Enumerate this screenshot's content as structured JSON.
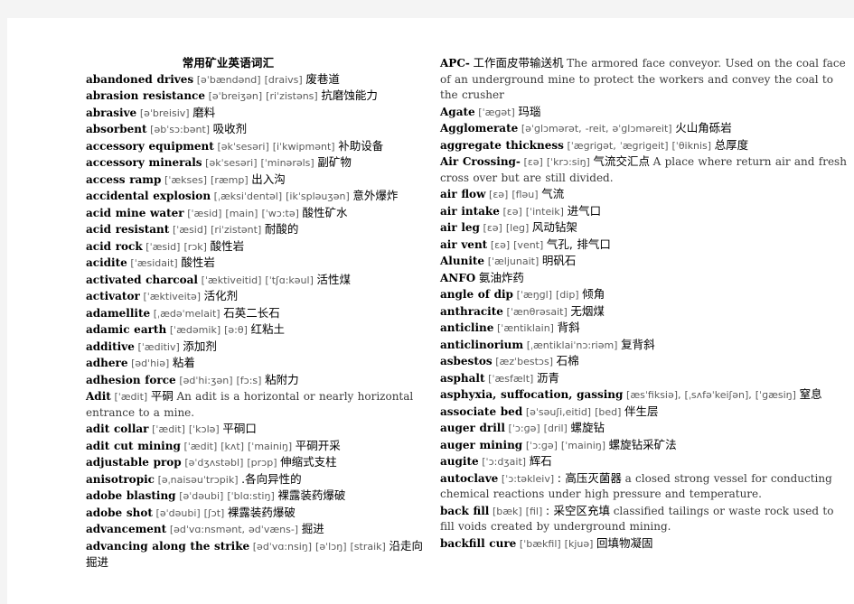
{
  "document": {
    "title": "常用矿业英语词汇",
    "background_color": "#f4f4f4",
    "page_color": "#ffffff",
    "text_color": "#000000",
    "phonetic_color": "#5a5a5a"
  },
  "left_column": {
    "entries": [
      {
        "headword": "abandoned drives",
        "phonetic": "[əˈbændənd]  [draivs]",
        "chinese": "废巷道",
        "english": ""
      },
      {
        "headword": "abrasion resistance",
        "phonetic": "[əˈbreiʒən] [riˈzistəns]",
        "chinese": "抗磨蚀能力",
        "english": ""
      },
      {
        "headword": "abrasive",
        "phonetic": "[əˈbreisiv]",
        "chinese": "磨料",
        "english": ""
      },
      {
        "headword": "absorbent",
        "phonetic": "[əbˈsɔ:bənt]",
        "chinese": "吸收剂",
        "english": ""
      },
      {
        "headword": "accessory equipment",
        "phonetic": "[əkˈsesəri] [iˈkwipmənt]",
        "chinese": "补助设备",
        "english": ""
      },
      {
        "headword": "accessory minerals",
        "phonetic": "[əkˈsesəri] [ˈminərəls]",
        "chinese": "副矿物",
        "english": ""
      },
      {
        "headword": "access ramp",
        "phonetic": "[ˈækses] [ræmp]",
        "chinese": "出入沟",
        "english": ""
      },
      {
        "headword": "accidental explosion",
        "phonetic": "[ˌæksiˈdentəl] [ikˈspləuʒən]",
        "chinese": "意外爆炸",
        "english": ""
      },
      {
        "headword": "acid mine water",
        "phonetic": "[ˈæsid] [main] [ˈwɔ:tə]",
        "chinese": "酸性矿水",
        "english": ""
      },
      {
        "headword": "acid resistant",
        "phonetic": "[ˈæsid] [riˈzistənt]",
        "chinese": "耐酸的",
        "english": ""
      },
      {
        "headword": "acid rock",
        "phonetic": "[ˈæsid] [rɔk]",
        "chinese": "酸性岩",
        "english": ""
      },
      {
        "headword": "acidite",
        "phonetic": "[ˈæsidait]",
        "chinese": "酸性岩",
        "english": ""
      },
      {
        "headword": "activated charcoal",
        "phonetic": "[ˈæktiveitid] [ˈtʃɑ:kəul]",
        "chinese": "活性煤",
        "english": ""
      },
      {
        "headword": "activator",
        "phonetic": "[ˈæktiveitə]",
        "chinese": "活化剂",
        "english": ""
      },
      {
        "headword": "adamellite",
        "phonetic": "[ˌædəˈmelait]",
        "chinese": "石英二长石",
        "english": ""
      },
      {
        "headword": "adamic earth",
        "phonetic": "[ˈædəmik] [ə:θ]",
        "chinese": "红粘土",
        "english": ""
      },
      {
        "headword": "additive",
        "phonetic": "[ˈæditiv]",
        "chinese": "添加剂",
        "english": ""
      },
      {
        "headword": "adhere",
        "phonetic": "[ədˈhiə]",
        "chinese": "粘着",
        "english": ""
      },
      {
        "headword": "adhesion force",
        "phonetic": "[ədˈhi:ʒən] [fɔ:s]",
        "chinese": "粘附力",
        "english": ""
      },
      {
        "headword": "Adit",
        "phonetic": "[ˈædit]",
        "chinese": "平硐",
        "english": "An adit is a horizontal or nearly horizontal entrance to a mine."
      },
      {
        "headword": "adit collar",
        "phonetic": "[ˈædit] [ˈkɔlə]",
        "chinese": "平硐口",
        "english": ""
      },
      {
        "headword": "adit cut mining",
        "phonetic": "[ˈædit] [kʌt] [ˈmainiŋ]",
        "chinese": "平硐开采",
        "english": ""
      },
      {
        "headword": "adjustable prop",
        "phonetic": "[əˈdʒʌstəbl] [prɔp]",
        "chinese": "伸缩式支柱",
        "english": ""
      },
      {
        "headword": "anisotropic",
        "phonetic": "[əˌnaisəuˈtrɔpik]",
        "chinese": ".各向异性的",
        "english": ""
      },
      {
        "headword": "adobe blasting",
        "phonetic": "[əˈdəubi] [ˈblɑ:stiŋ]",
        "chinese": "裸露装药爆破",
        "english": ""
      },
      {
        "headword": "adobe shot",
        "phonetic": "[əˈdəubi] [ʃɔt]",
        "chinese": "裸露装药爆破",
        "english": ""
      },
      {
        "headword": "advancement",
        "phonetic": "[ədˈvɑ:nsmənt, ədˈvæns-]",
        "chinese": "掘进",
        "english": ""
      },
      {
        "headword": "advancing along the strike",
        "phonetic": "[ədˈvɑ:nsiŋ] [əˈlɔŋ]  [straik]",
        "chinese": "沿走向掘进",
        "english": ""
      }
    ]
  },
  "right_column": {
    "entries": [
      {
        "headword": "APC-",
        "phonetic": "",
        "chinese": "工作面皮带输送机",
        "english": "The armored face  conveyor. Used on the coal face of an underground mine to protect the workers and convey the coal to the crusher"
      },
      {
        "headword": "Agate",
        "phonetic": "[ˈæɡət]",
        "chinese": "玛瑙",
        "english": ""
      },
      {
        "headword": "Agglomerate",
        "phonetic": "[əˈɡlɔmərət, -reit, əˈɡlɔməreit]",
        "chinese": "火山角砾岩",
        "english": ""
      },
      {
        "headword": "aggregate thickness",
        "phonetic": "[ˈæɡriɡət, ˈæɡriɡeit] [ˈθiknis]",
        "chinese": "总厚度",
        "english": ""
      },
      {
        "headword": "Air Crossing-",
        "phonetic": "[ɛə] [ˈkrɔ:siŋ]",
        "chinese": "气流交汇点",
        "english": "A place where return air and fresh cross over but are still divided."
      },
      {
        "headword": "air flow",
        "phonetic": "[ɛə] [fləu]",
        "chinese": "气流",
        "english": ""
      },
      {
        "headword": "air intake",
        "phonetic": "[ɛə] [ˈinteik]",
        "chinese": "进气口",
        "english": ""
      },
      {
        "headword": "air leg",
        "phonetic": "[ɛə] [leɡ]",
        "chinese": "风动钻架",
        "english": ""
      },
      {
        "headword": "air vent",
        "phonetic": "[ɛə]  [vent]",
        "chinese": "气孔, 排气口",
        "english": ""
      },
      {
        "headword": "Alunite",
        "phonetic": "[ˈæljunait]",
        "chinese": "明矾石",
        "english": ""
      },
      {
        "headword": "ANFO",
        "phonetic": "",
        "chinese": "氨油炸药",
        "english": ""
      },
      {
        "headword": "angle of dip",
        "phonetic": "[ˈæŋɡl] [dip]",
        "chinese": "倾角",
        "english": ""
      },
      {
        "headword": "anthracite",
        "phonetic": "[ˈænθrəsait]",
        "chinese": "无烟煤",
        "english": ""
      },
      {
        "headword": "anticline",
        "phonetic": "[ˈæntiklain]",
        "chinese": "背斜",
        "english": ""
      },
      {
        "headword": "anticlinorium",
        "phonetic": "[ˌæntiklaiˈnɔ:riəm]",
        "chinese": "复背斜",
        "english": ""
      },
      {
        "headword": "asbestos",
        "phonetic": "[æzˈbestɔs]",
        "chinese": "石棉",
        "english": ""
      },
      {
        "headword": "asphalt",
        "phonetic": "[ˈæsfælt]",
        "chinese": "沥青",
        "english": ""
      },
      {
        "headword": "asphyxia, suffocation, gassing",
        "phonetic": "[æsˈfiksiə], [ˌsʌfəˈkeiʃən], [ˈɡæsiŋ]",
        "chinese": "窒息",
        "english": ""
      },
      {
        "headword": "associate bed",
        "phonetic": "[əˈsəuʃi,eitid] [bed]",
        "chinese": "伴生层",
        "english": ""
      },
      {
        "headword": "auger drill",
        "phonetic": "[ˈɔ:ɡə] [dril]",
        "chinese": "螺旋钻",
        "english": ""
      },
      {
        "headword": "auger mining",
        "phonetic": "[ˈɔ:ɡə] [ˈmainiŋ]",
        "chinese": "螺旋钻采矿法",
        "english": ""
      },
      {
        "headword": "augite",
        "phonetic": "[ˈɔ:dʒait]",
        "chinese": "辉石",
        "english": ""
      },
      {
        "headword": "autoclave",
        "phonetic": "[ˈɔ:təkleiv]",
        "chinese": ": 高压灭菌器",
        "english": "a closed strong vessel for conducting chemical reactions under high pressure and temperature."
      },
      {
        "headword": "back fill",
        "phonetic": "[bæk] [fil]",
        "chinese": ": 采空区充填",
        "english": "classified tailings or waste rock used to fill voids created by underground mining."
      },
      {
        "headword": "backfill cure",
        "phonetic": "[ˈbækfil] [kjuə]",
        "chinese": "回填物凝固",
        "english": ""
      }
    ]
  }
}
